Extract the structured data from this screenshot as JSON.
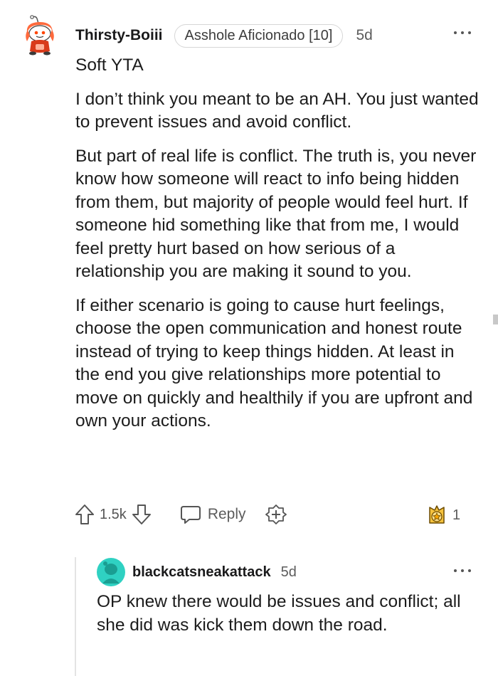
{
  "comment": {
    "username": "Thirsty-Boiii",
    "flair": "Asshole Aficionado [10]",
    "age": "5d",
    "paragraphs": [
      "Soft YTA",
      "I don’t think you meant to be an AH. You just wanted to prevent issues and avoid conflict.",
      "But part of real life is conflict. The truth is, you never know how someone will react to info being hidden from them, but majority of people would feel hurt. If someone hid something like that from me, I would feel pretty hurt based on how serious of a relationship you are making it sound to you.",
      "If either scenario is going to cause hurt feelings, choose the open communication and honest route instead of trying to keep things hidden. At least in the end you give relationships more potential to move on quickly and healthily if you are upfront and own your actions."
    ],
    "vote_count": "1.5k",
    "reply_label": "Reply",
    "award_count": "1",
    "icons": {
      "avatar": "snoo-avatar-icon",
      "more": "more-options-icon",
      "upvote": "upvote-arrow-icon",
      "downvote": "downvote-arrow-icon",
      "reply": "reply-bubble-icon",
      "award": "give-award-icon",
      "received_award": "award-badge-icon"
    }
  },
  "reply": {
    "username": "blackcatsneakattack",
    "age": "5d",
    "text": "OP knew there would be issues and conflict; all she did was kick them down the road."
  },
  "colors": {
    "text": "#1c1c1c",
    "muted": "#5c5c5c",
    "avatar_teal": "#2fd1c2",
    "award_gold": "#f5c23d"
  }
}
